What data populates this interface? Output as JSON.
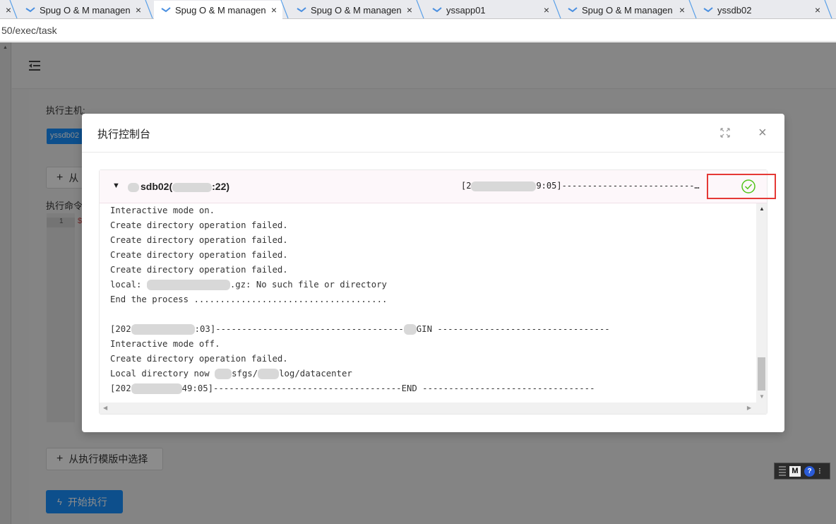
{
  "browser": {
    "tabs": [
      {
        "label": "",
        "active": false
      },
      {
        "label": "Spug O & M managen",
        "active": false
      },
      {
        "label": "Spug O & M managen",
        "active": true
      },
      {
        "label": "Spug O & M managen",
        "active": false
      },
      {
        "label": "yssapp01",
        "active": false
      },
      {
        "label": "Spug O & M managen",
        "active": false
      },
      {
        "label": "yssdb02",
        "active": false
      }
    ],
    "close_glyph": "×",
    "url": "50/exec/task"
  },
  "page": {
    "hosts_label": "执行主机:",
    "host_tag": "yssdb02",
    "add_host_button": "从",
    "command_label": "执行命令",
    "editor_line_number": "1",
    "editor_first_char": "$",
    "template_button": "从执行模版中选择",
    "start_button": "开始执行"
  },
  "modal": {
    "title": "执行控制台",
    "host_prefix": "sdb02(",
    "host_suffix": ":22)",
    "time_prefix": "[2",
    "time_suffix": "9:05]--------------------------…",
    "status": "success",
    "log_lines": [
      {
        "text": "Interactive mode on."
      },
      {
        "text": "Create directory operation failed."
      },
      {
        "text": "Create directory operation failed."
      },
      {
        "text": "Create directory operation failed."
      },
      {
        "text": "Create directory operation failed."
      },
      {
        "pre": "local: ",
        "post": ".gz: No such file or directory"
      },
      {
        "text": "End the process ....................................."
      },
      {
        "text": ""
      },
      {
        "pre": "[202",
        "post": ":03]------------------------------------",
        "post2": "GIN ---------------------------------"
      },
      {
        "text": "Interactive mode off."
      },
      {
        "text": "Create directory operation failed."
      },
      {
        "pre": "Local directory now ",
        "post": "sfgs/",
        "post2": "log/datacenter"
      },
      {
        "pre": "[202",
        "post": "49:05]------------------------------------END ---------------------------------"
      }
    ]
  },
  "floating_tool": {
    "m": "M",
    "help": "?",
    "more": "⁝"
  },
  "colors": {
    "primary": "#1890ff",
    "success": "#52c41a",
    "highlight": "#e53935"
  }
}
